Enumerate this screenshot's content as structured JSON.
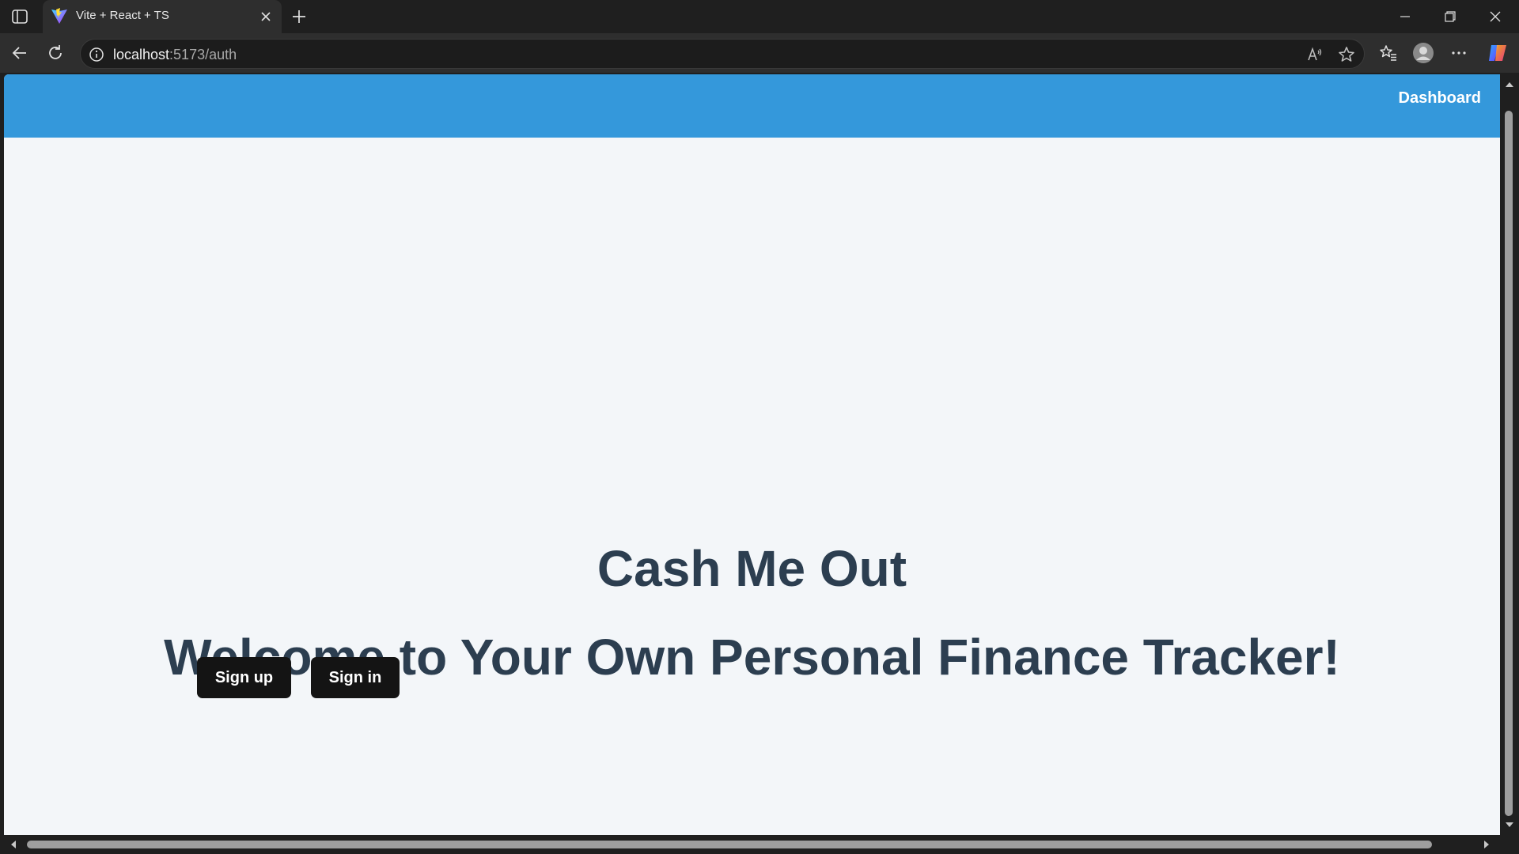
{
  "browser": {
    "tab_title": "Vite + React + TS",
    "url_host": "localhost",
    "url_path": ":5173/auth"
  },
  "app": {
    "nav_dashboard": "Dashboard",
    "title": "Cash Me Out",
    "subtitle": "Welcome to Your Own Personal Finance Tracker!",
    "signup_label": "Sign up",
    "signin_label": "Sign in"
  },
  "colors": {
    "header_bg": "#3498db",
    "page_bg": "#f3f6f9",
    "heading_text": "#2c3e50",
    "button_bg": "#141414"
  }
}
